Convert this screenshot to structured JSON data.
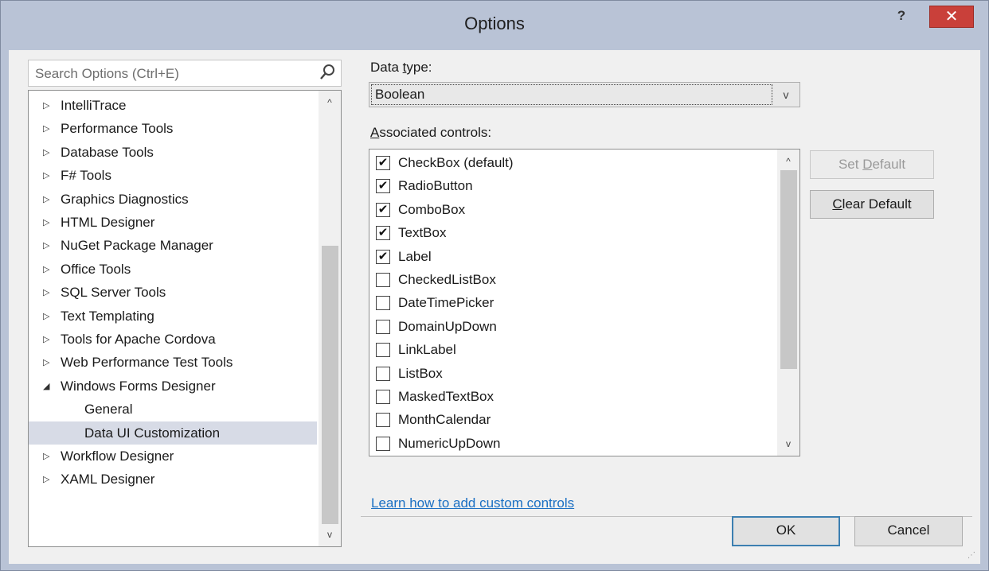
{
  "window": {
    "title": "Options",
    "help_label": "?",
    "close_label": "✕"
  },
  "search": {
    "placeholder": "Search Options (Ctrl+E)"
  },
  "tree": {
    "items": [
      {
        "label": "IntelliTrace",
        "expander": "▷"
      },
      {
        "label": "Performance Tools",
        "expander": "▷"
      },
      {
        "label": "Database Tools",
        "expander": "▷"
      },
      {
        "label": "F# Tools",
        "expander": "▷"
      },
      {
        "label": "Graphics Diagnostics",
        "expander": "▷"
      },
      {
        "label": "HTML Designer",
        "expander": "▷"
      },
      {
        "label": "NuGet Package Manager",
        "expander": "▷"
      },
      {
        "label": "Office Tools",
        "expander": "▷"
      },
      {
        "label": "SQL Server Tools",
        "expander": "▷"
      },
      {
        "label": "Text Templating",
        "expander": "▷"
      },
      {
        "label": "Tools for Apache Cordova",
        "expander": "▷"
      },
      {
        "label": "Web Performance Test Tools",
        "expander": "▷"
      },
      {
        "label": "Windows Forms Designer",
        "expander": "◢"
      },
      {
        "label": "General",
        "expander": ""
      },
      {
        "label": "Data UI Customization",
        "expander": ""
      },
      {
        "label": "Workflow Designer",
        "expander": "▷"
      },
      {
        "label": "XAML Designer",
        "expander": "▷"
      }
    ]
  },
  "data_type": {
    "label_before": "Data ",
    "label_access": "t",
    "label_after": "ype:",
    "value": "Boolean"
  },
  "associated": {
    "label_access": "A",
    "label_after": "ssociated controls:",
    "items": [
      {
        "label": "CheckBox (default)",
        "checked": true,
        "mark": "✔"
      },
      {
        "label": "RadioButton",
        "checked": true,
        "mark": "✔"
      },
      {
        "label": "ComboBox",
        "checked": true,
        "mark": "✔"
      },
      {
        "label": "TextBox",
        "checked": true,
        "mark": "✔"
      },
      {
        "label": "Label",
        "checked": true,
        "mark": "✔"
      },
      {
        "label": "CheckedListBox",
        "checked": false,
        "mark": ""
      },
      {
        "label": "DateTimePicker",
        "checked": false,
        "mark": ""
      },
      {
        "label": "DomainUpDown",
        "checked": false,
        "mark": ""
      },
      {
        "label": "LinkLabel",
        "checked": false,
        "mark": ""
      },
      {
        "label": "ListBox",
        "checked": false,
        "mark": ""
      },
      {
        "label": "MaskedTextBox",
        "checked": false,
        "mark": ""
      },
      {
        "label": "MonthCalendar",
        "checked": false,
        "mark": ""
      },
      {
        "label": "NumericUpDown",
        "checked": false,
        "mark": ""
      }
    ]
  },
  "buttons": {
    "set_default_before": "Set ",
    "set_default_access": "D",
    "set_default_after": "efault",
    "clear_default_access": "C",
    "clear_default_after": "lear Default",
    "ok": "OK",
    "cancel": "Cancel"
  },
  "link": {
    "text": "Learn how to add custom controls"
  },
  "scroll": {
    "up": "^",
    "down": "v"
  }
}
